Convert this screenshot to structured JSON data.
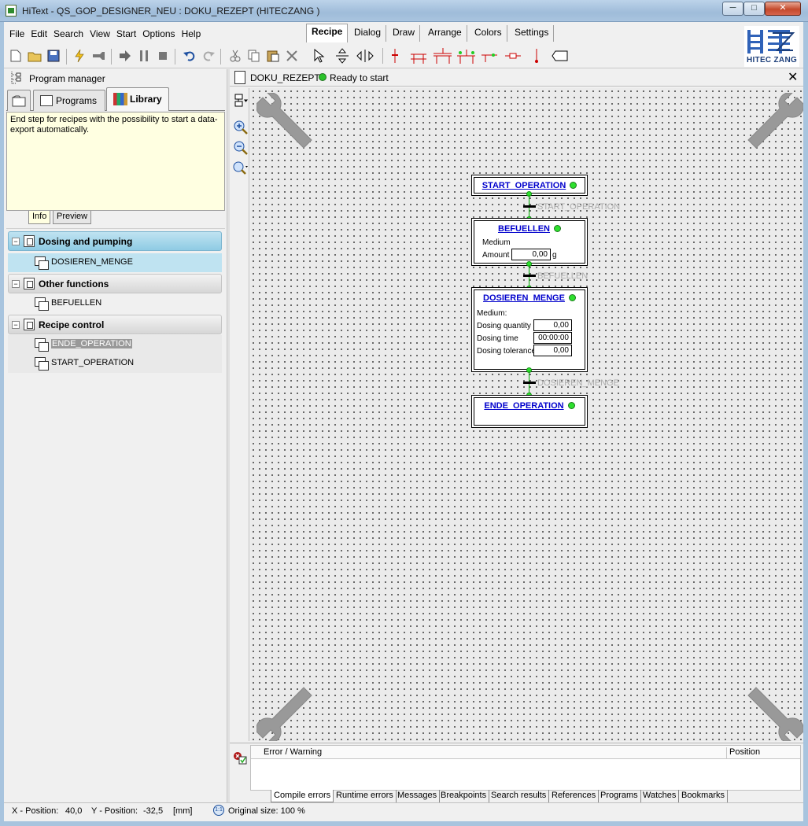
{
  "window": {
    "title": "HiText - QS_GOP_DESIGNER_NEU : DOKU_REZEPT       (HITECZANG )",
    "minimize": "─",
    "maximize": "□",
    "close": "✕"
  },
  "menu": [
    "File",
    "Edit",
    "Search",
    "View",
    "Start",
    "Options",
    "Help"
  ],
  "ribbon_tabs": [
    "Recipe",
    "Dialog",
    "Draw",
    "Arrange",
    "Colors",
    "Settings"
  ],
  "logo": {
    "text": "HITEC ZANG"
  },
  "program_manager": {
    "title": "Program manager",
    "tabs": [
      "Programs",
      "Library"
    ],
    "info_text": "End step for recipes with the possibility to start a data-export automatically.",
    "info_tabs": [
      "Info",
      "Preview"
    ],
    "groups": [
      {
        "label": "Dosing and pumping",
        "items": [
          "DOSIEREN_MENGE"
        ]
      },
      {
        "label": "Other functions",
        "items": [
          "BEFUELLEN"
        ]
      },
      {
        "label": "Recipe control",
        "items": [
          "ENDE_OPERATION",
          "START_OPERATION"
        ]
      }
    ]
  },
  "document": {
    "name": "DOKU_REZEPT",
    "status": "Ready to start",
    "close": "✕"
  },
  "diagram": {
    "steps": {
      "start": {
        "title": "START_OPERATION"
      },
      "befuellen": {
        "title": "BEFUELLEN",
        "medium_label": "Medium",
        "amount_label": "Amount",
        "amount_value": "0,00",
        "amount_unit": "g"
      },
      "dosieren": {
        "title": "DOSIEREN_MENGE",
        "medium_label": "Medium:",
        "qty_label": "Dosing quantity",
        "qty_value": "0,00",
        "time_label": "Dosing time",
        "time_value": "00:00:00",
        "tol_label": "Dosing tolerance",
        "tol_value": "0,00"
      },
      "ende": {
        "title": "ENDE_OPERATION"
      }
    },
    "transitions": [
      "START_OPERATION",
      "BEFUELLEN",
      "DOSIEREN_MENGE"
    ]
  },
  "errors": {
    "col_error": "Error / Warning",
    "col_position": "Position",
    "tabs": [
      "Compile errors",
      "Runtime errors",
      "Messages",
      "Breakpoints",
      "Search results",
      "References",
      "Programs",
      "Watches",
      "Bookmarks"
    ]
  },
  "statusbar": {
    "x_label": "X - Position:",
    "x_value": "40,0",
    "y_label": "Y - Position:",
    "y_value": "-32,5",
    "unit": "[mm]",
    "zoom_icon": "1:1",
    "zoom": "Original size: 100 %"
  },
  "colors": {
    "accent": "#0000cc",
    "status_green": "#2ee02e",
    "selection": "#bfe3f1"
  }
}
